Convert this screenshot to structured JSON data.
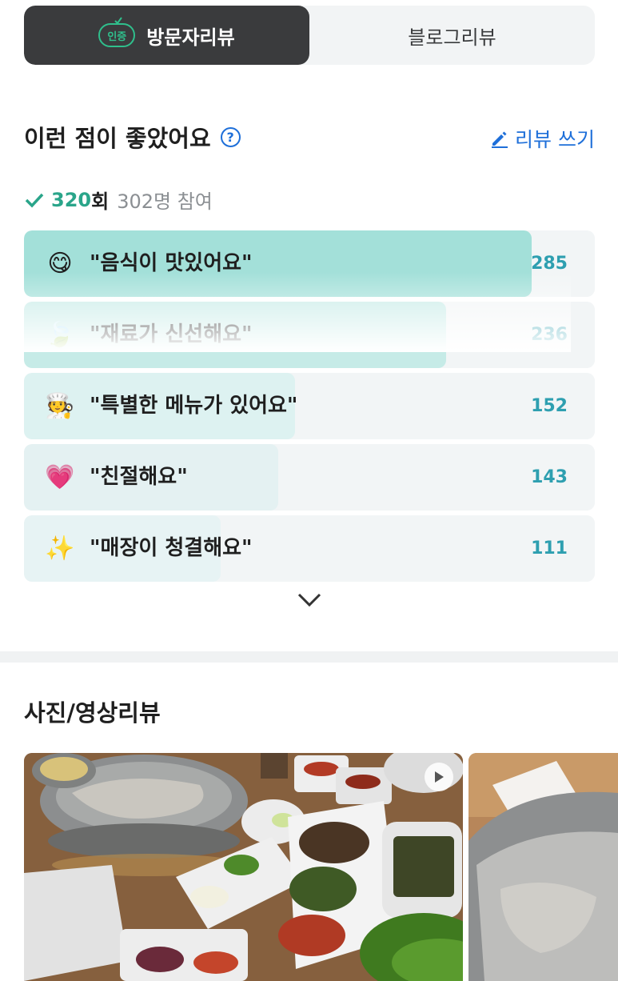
{
  "tabs": {
    "visit_badge": "인증",
    "visit_label": "방문자리뷰",
    "blog_label": "블로그리뷰"
  },
  "keywords": {
    "title": "이런 점이 좋았어요",
    "help_symbol": "?",
    "write_label": "리뷰 쓰기",
    "count": "320",
    "count_unit": "회",
    "participants": "302명 참여",
    "items": [
      {
        "label": "\"음식이 맛있어요\"",
        "count": "285",
        "emoji": "smiling-face-icon",
        "glyph": "😋",
        "fill": 0.89,
        "color": "#a3e0d9"
      },
      {
        "label": "\"재료가 신선해요\"",
        "count": "236",
        "emoji": "leaf-icon",
        "glyph": "🍃",
        "fill": 0.74,
        "color": "#c6ebe7"
      },
      {
        "label": "\"특별한 메뉴가 있어요\"",
        "count": "152",
        "emoji": "chef-icon",
        "glyph": "🧑‍🍳",
        "fill": 0.475,
        "color": "#ddf2f1"
      },
      {
        "label": "\"친절해요\"",
        "count": "143",
        "emoji": "heart-face-icon",
        "glyph": "💗",
        "fill": 0.445,
        "color": "#e4f1f2"
      },
      {
        "label": "\"매장이 청결해요\"",
        "count": "111",
        "emoji": "sparkles-icon",
        "glyph": "✨",
        "fill": 0.345,
        "color": "#e7f3f4"
      }
    ]
  },
  "photos": {
    "title": "사진/영상리뷰"
  }
}
